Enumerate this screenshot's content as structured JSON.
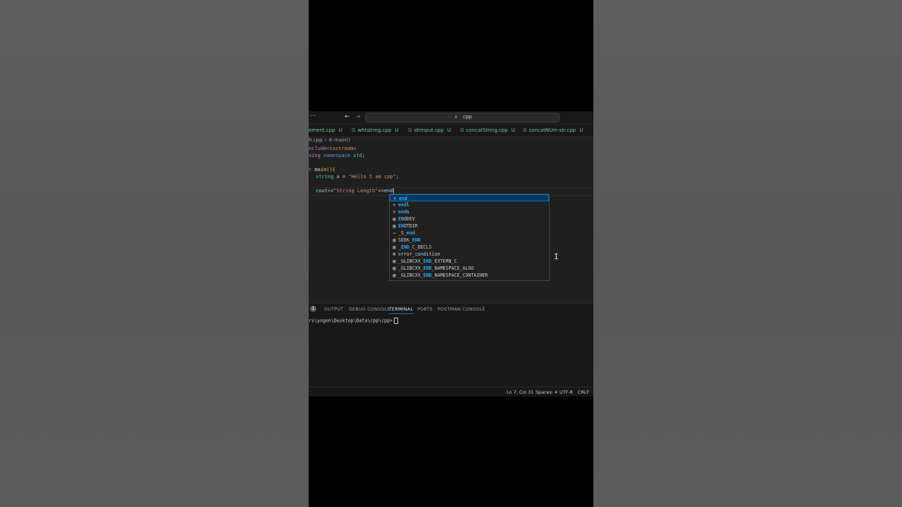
{
  "window": {
    "search_text": "cpp",
    "more_label": "···"
  },
  "tabs": [
    {
      "name": "ement.cpp",
      "status": "U"
    },
    {
      "name": "whtstring.cpp",
      "status": "U"
    },
    {
      "name": "strinput.cpp",
      "status": "U"
    },
    {
      "name": "concatString.cpp",
      "status": "U"
    },
    {
      "name": "concatNUm-str.cpp",
      "status": "U"
    }
  ],
  "breadcrumb": {
    "file": "h.cpp",
    "symbol": "main()"
  },
  "code": {
    "line1_a": "nclude",
    "line1_b": "<iostream>",
    "line2_a": "sing ",
    "line2_b": "namespace ",
    "line2_c": "std",
    "line2_d": ";",
    "line4_a": "t ",
    "line4_b": "main",
    "line4_c": "(){",
    "line5_a": "string ",
    "line5_b": "a",
    "line5_c": " = ",
    "line5_d": "\"Hello I am cpp\"",
    "line5_e": ";",
    "line7_a": "cout",
    "line7_b": "<<",
    "line7_c": "\"String Length\"",
    "line7_d": "<<",
    "line7_e": "end"
  },
  "suggestions": [
    {
      "icon": "namespace-icon",
      "hl": "end",
      "rest": ""
    },
    {
      "icon": "namespace-icon",
      "hl": "end",
      "rest": "l"
    },
    {
      "icon": "namespace-icon",
      "hl": "end",
      "rest": "s"
    },
    {
      "icon": "constant-icon",
      "pre": "",
      "hl": "EN",
      "rest": "ODEV"
    },
    {
      "icon": "constant-icon",
      "pre": "",
      "hl": "EN",
      "rest": "OTDIR"
    },
    {
      "icon": "link-icon",
      "pre": "_S_",
      "hl": "end",
      "rest": ""
    },
    {
      "icon": "constant-icon",
      "pre": "SEEK_",
      "hl": "END",
      "rest": ""
    },
    {
      "icon": "constant-icon",
      "pre": "_",
      "hl": "END",
      "rest": "_C_DECLS"
    },
    {
      "icon": "enum-icon",
      "pre": "",
      "hl": "e",
      "rest": "rror_co",
      "hl2": "n",
      "rest2": "dition"
    },
    {
      "icon": "constant-icon",
      "pre": "_GLIBCXX_",
      "hl": "END",
      "rest": "_EXTERN_C"
    },
    {
      "icon": "constant-icon",
      "pre": "_GLIBCXX_",
      "hl": "END",
      "rest": "_NAMESPACE_ALGO"
    },
    {
      "icon": "constant-icon",
      "pre": "_GLIBCXX_",
      "hl": "END",
      "rest": "_NAMESPACE_CONTAINER"
    }
  ],
  "panel": {
    "problems_count": "1",
    "tabs": [
      "OUTPUT",
      "DEBUG CONSOLE",
      "TERMINAL",
      "PORTS",
      "POSTMAN CONSOLE"
    ],
    "active_tab": "TERMINAL",
    "terminal_prompt": "rs\\yogen\\Desktop\\Data\\cpp\\cpp>"
  },
  "statusbar": {
    "position": "Ln 7, Col 31",
    "spaces": "Spaces: 4",
    "encoding": "UTF-8",
    "eol": "CRLF"
  },
  "colors": {
    "accent": "#0078d4",
    "modified_tab": "#73c991",
    "editor_bg": "#1f1f1f"
  }
}
